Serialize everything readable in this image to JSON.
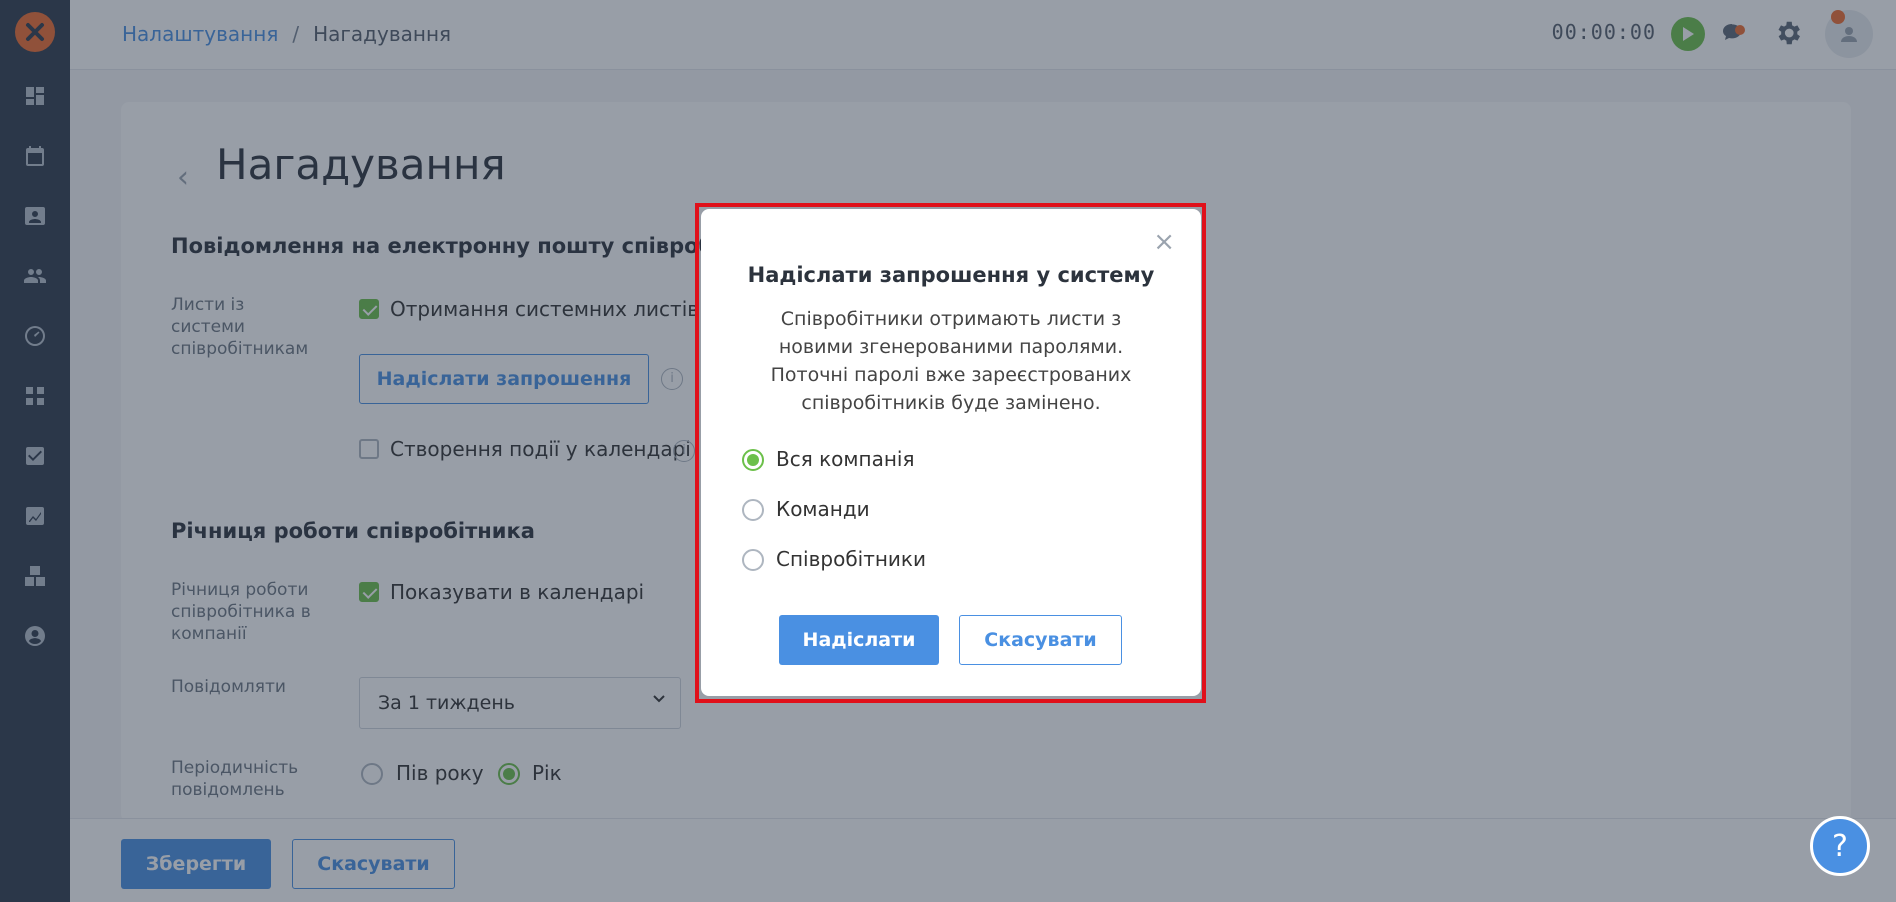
{
  "breadcrumb": {
    "parent": "Налаштування",
    "separator": "/",
    "current": "Нагадування"
  },
  "topbar": {
    "timer": "00:00:00"
  },
  "page": {
    "title": "Нагадування",
    "email_section": {
      "title": "Повідомлення на електронну пошту співробітника",
      "letters_label": "Листи із системи співробітникам",
      "system_letters_checkbox": {
        "label": "Отримання системних листів спі",
        "checked": true
      },
      "send_invite_button": "Надіслати запрошення",
      "create_event_checkbox": {
        "label": "Створення події у календарі",
        "checked": false
      }
    },
    "anniversary_section": {
      "title": "Річниця роботи співробітника",
      "anniversary_label": "Річниця роботи співробітника в компанії",
      "show_in_calendar_checkbox": {
        "label": "Показувати в календарі",
        "checked": true
      },
      "notify_label": "Повідомляти",
      "notify_select_value": "За 1 тиждень",
      "frequency_label": "Періодичність повідомлень",
      "frequency_options": [
        {
          "label": "Пів року",
          "selected": false
        },
        {
          "label": "Рік",
          "selected": true
        }
      ]
    }
  },
  "footer": {
    "save_label": "Зберегти",
    "cancel_label": "Скасувати"
  },
  "help": {
    "label": "?"
  },
  "modal": {
    "title": "Надіслати запрошення у систему",
    "description": "Співробітники отримають листи з новими згенерованими паролями. Поточні паролі вже зареєстрованих співробітників буде замінено.",
    "options": [
      {
        "label": "Вся компанія",
        "selected": true
      },
      {
        "label": "Команди",
        "selected": false
      },
      {
        "label": "Співробітники",
        "selected": false
      }
    ],
    "submit_label": "Надіслати",
    "cancel_label": "Скасувати",
    "close_glyph": "×"
  },
  "colors": {
    "sidebar": "#2f3b4c",
    "accent": "#4a90e2",
    "success": "#6cc04a",
    "brand": "#ef6c2f",
    "highlight": "#e0101a"
  }
}
